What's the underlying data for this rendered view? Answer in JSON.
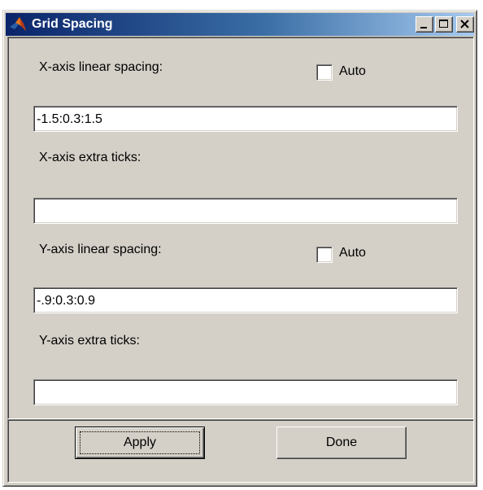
{
  "window": {
    "title": "Grid Spacing",
    "icon": "matlab-icon",
    "controls": [
      "minimize-icon",
      "maximize-icon",
      "close-icon"
    ]
  },
  "x_axis": {
    "spacing_label": "X-axis linear spacing:",
    "auto_label": "Auto",
    "auto_checked": false,
    "spacing_value": "-1.5:0.3:1.5",
    "extra_ticks_label": "X-axis extra ticks:",
    "extra_ticks_value": ""
  },
  "y_axis": {
    "spacing_label": "Y-axis linear spacing:",
    "auto_label": "Auto",
    "auto_checked": false,
    "spacing_value": "-.9:0.3:0.9",
    "extra_ticks_label": "Y-axis extra ticks:",
    "extra_ticks_value": ""
  },
  "buttons": {
    "apply_label": "Apply",
    "done_label": "Done"
  },
  "colors": {
    "titlebar_start": "#0a246a",
    "titlebar_end": "#a6caf0",
    "face": "#d4d0c8"
  }
}
